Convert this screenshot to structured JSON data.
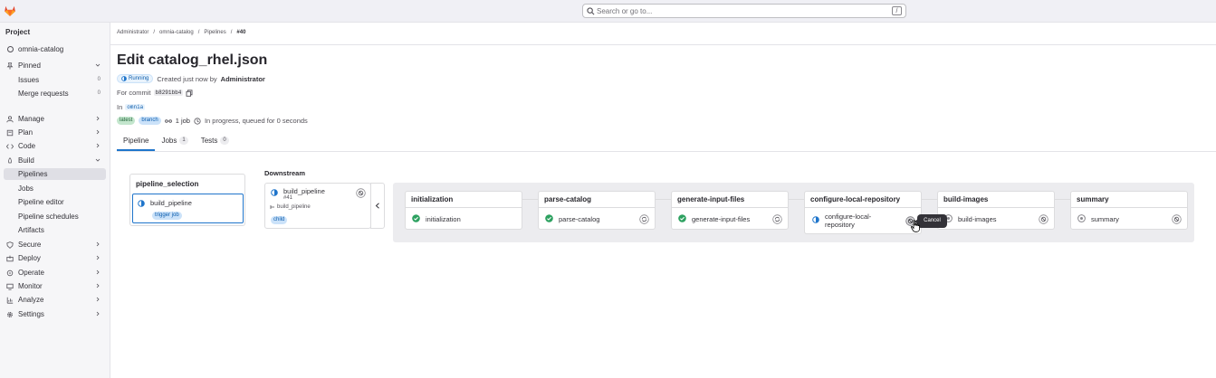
{
  "topbar": {
    "search_placeholder": "Search or go to...",
    "search_shortcut": "/"
  },
  "sidebar": {
    "heading": "Project",
    "project": "omnia-catalog",
    "items": [
      {
        "label": "Pinned",
        "icon": "pin-icon"
      },
      {
        "label": "Issues",
        "count": "0"
      },
      {
        "label": "Merge requests",
        "count": "0"
      },
      {
        "label": "Manage",
        "icon": "users-icon"
      },
      {
        "label": "Plan",
        "icon": "plan-icon"
      },
      {
        "label": "Code",
        "icon": "code-icon"
      },
      {
        "label": "Build",
        "icon": "rocket-icon"
      },
      {
        "label": "Pipelines"
      },
      {
        "label": "Jobs"
      },
      {
        "label": "Pipeline editor"
      },
      {
        "label": "Pipeline schedules"
      },
      {
        "label": "Artifacts"
      },
      {
        "label": "Secure",
        "icon": "shield-icon"
      },
      {
        "label": "Deploy",
        "icon": "deploy-icon"
      },
      {
        "label": "Operate",
        "icon": "operate-icon"
      },
      {
        "label": "Monitor",
        "icon": "monitor-icon"
      },
      {
        "label": "Analyze",
        "icon": "chart-icon"
      },
      {
        "label": "Settings",
        "icon": "gear-icon"
      }
    ]
  },
  "breadcrumb": [
    "Administrator",
    "omnia-catalog",
    "Pipelines",
    "#40"
  ],
  "pipeline": {
    "title": "Edit catalog_rhel.json",
    "status": "Running",
    "created": "Created just now by",
    "author": "Administrator",
    "commit_label": "For commit",
    "commit_sha": "b8291bb4",
    "in_label": "In",
    "ref": "omnia",
    "tags": [
      "latest",
      "branch"
    ],
    "jobs_count": "1 job",
    "progress_text": "In progress, queued for 0 seconds"
  },
  "tabs": [
    {
      "label": "Pipeline",
      "count": ""
    },
    {
      "label": "Jobs",
      "count": "1"
    },
    {
      "label": "Tests",
      "count": "0"
    }
  ],
  "upstream": {
    "title": "pipeline_selection",
    "job": "build_pipeline",
    "tag": "trigger job"
  },
  "downstream": {
    "heading": "Downstream",
    "name": "build_pipeline",
    "id": "#41",
    "source": "build_pipeline",
    "tag": "child"
  },
  "stages": [
    {
      "name": "initialization",
      "job": "initialization",
      "status": "success"
    },
    {
      "name": "parse-catalog",
      "job": "parse-catalog",
      "status": "success"
    },
    {
      "name": "generate-input-files",
      "job": "generate-input-files",
      "status": "success"
    },
    {
      "name": "configure-local-repository",
      "job": "configure-local-repository",
      "status": "running"
    },
    {
      "name": "build-images",
      "job": "build-images",
      "status": "pending"
    },
    {
      "name": "summary",
      "job": "summary",
      "status": "pending"
    }
  ],
  "tooltip": "Cancel",
  "colors": {
    "success": "#2da160",
    "running": "#1f75cb",
    "brand": "#e24329"
  }
}
